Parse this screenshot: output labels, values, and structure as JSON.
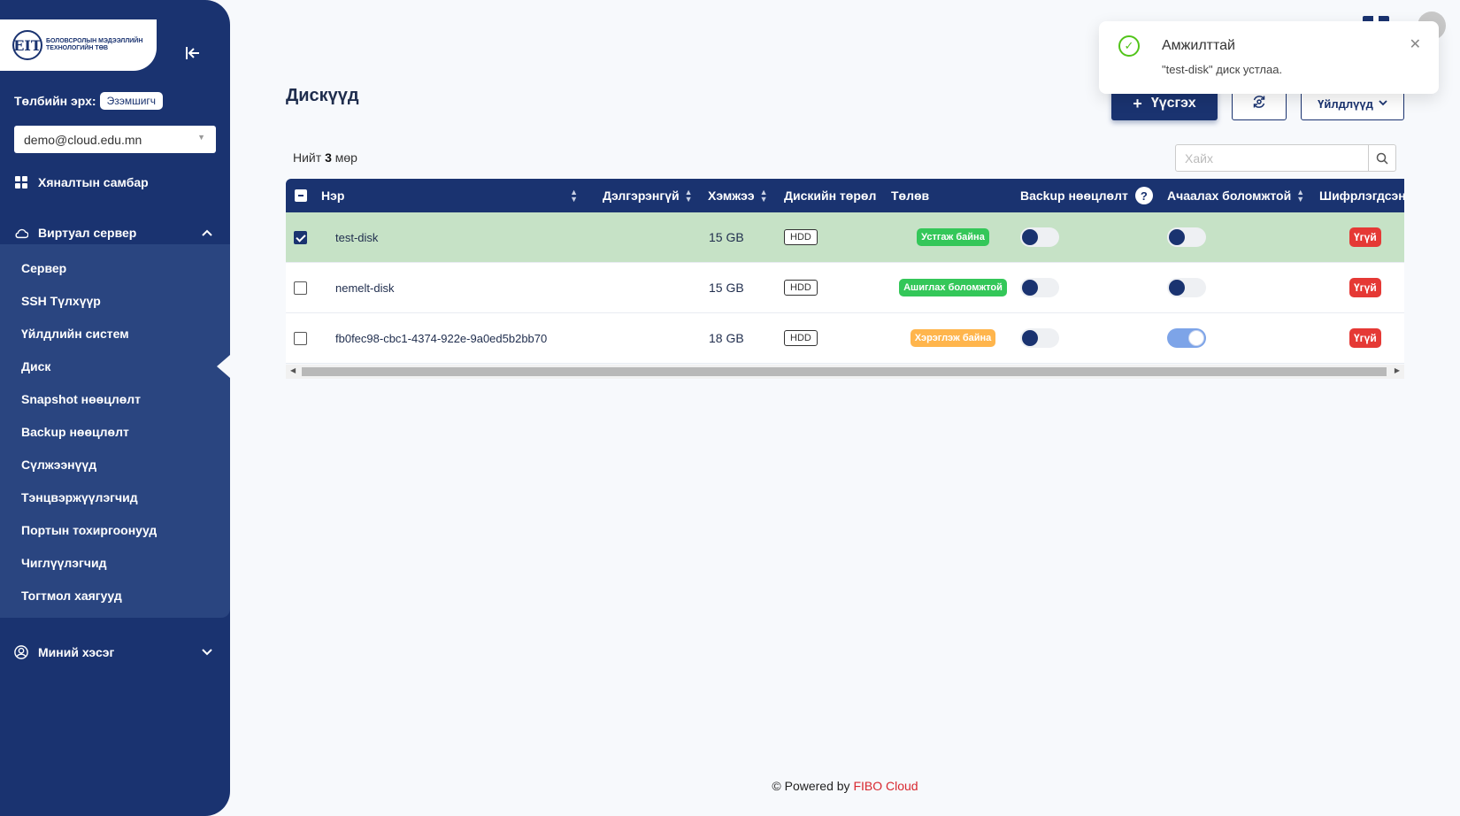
{
  "brand": {
    "logo_mark": "EIT",
    "logo_text": "БОЛОВСРОЛЫН МЭДЭЭЛЛИЙН ТЕХНОЛОГИЙН ТӨВ"
  },
  "sidebar": {
    "role_label": "Төлбийн эрх:",
    "role_value": "Эзэмшигч",
    "account": "demo@cloud.edu.mn",
    "dashboard": "Хяналтын самбар",
    "group_label": "Виртуал сервер",
    "items": [
      {
        "label": "Сервер"
      },
      {
        "label": "SSH Түлхүүр"
      },
      {
        "label": "Үйлдлийн систем"
      },
      {
        "label": "Диск"
      },
      {
        "label": "Snapshot нөөцлөлт"
      },
      {
        "label": "Backup нөөцлөлт"
      },
      {
        "label": "Сүлжээнүүд"
      },
      {
        "label": "Тэнцвэржүүлэгчид"
      },
      {
        "label": "Портын тохиргоонууд"
      },
      {
        "label": "Чиглүүлэгчид"
      },
      {
        "label": "Тогтмол хаягууд"
      }
    ],
    "active_item": "Диск",
    "my_section": "Миний хэсэг"
  },
  "toast": {
    "title": "Амжилттай",
    "message": "\"test-disk\" диск устлаа."
  },
  "page": {
    "title": "Дискүүд",
    "create_label": "Үүсгэх",
    "actions_label": "Үйлдлүүд",
    "total_prefix": "Нийт",
    "total_count": "3",
    "total_suffix": "мөр",
    "search_placeholder": "Хайх"
  },
  "table": {
    "columns": {
      "name": "Нэр",
      "details": "Дэлгэрэнгүй",
      "size": "Хэмжээ",
      "type": "Дискийн төрөл",
      "status": "Төлөв",
      "backup": "Backup нөөцлөлт",
      "bootable": "Ачаалах боломжтой",
      "encrypted": "Шифрлэгдсэн"
    },
    "rows": [
      {
        "name": "test-disk",
        "size": "15 GB",
        "type": "HDD",
        "status": "Устгаж байна",
        "status_color": "#34c759",
        "backup": false,
        "bootable": false,
        "encrypted": "Үгүй",
        "selected": true
      },
      {
        "name": "nemelt-disk",
        "size": "15 GB",
        "type": "HDD",
        "status": "Ашиглах боломжтой",
        "status_color": "#34c759",
        "backup": false,
        "bootable": false,
        "encrypted": "Үгүй",
        "selected": false
      },
      {
        "name": "fb0fec98-cbc1-4374-922e-9a0ed5b2bb70",
        "size": "18 GB",
        "type": "HDD",
        "status": "Хэрэглэж байна",
        "status_color": "#ffb54c",
        "backup": false,
        "bootable": true,
        "encrypted": "Үгүй",
        "selected": false
      }
    ]
  },
  "footer": {
    "prefix": "© Powered by",
    "brand": "FIBO Cloud"
  },
  "colors": {
    "primary": "#1a3370",
    "sidebar_sub": "#2a4580",
    "selected_row": "#c6e2c6",
    "danger": "#e53935",
    "success": "#52c41a"
  }
}
